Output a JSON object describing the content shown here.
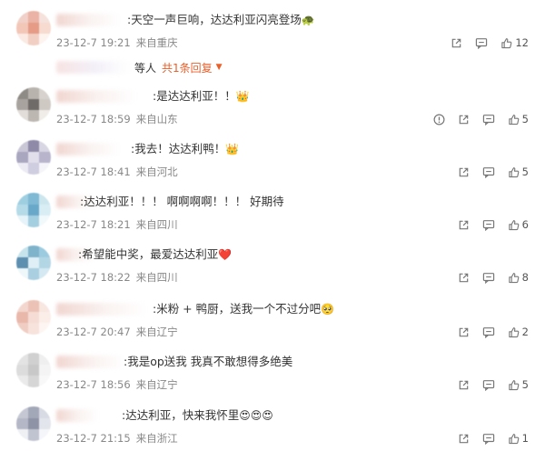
{
  "comments": [
    {
      "text": ":天空一声巨响，达达利亚闪亮登场",
      "text_emoji": "🐢",
      "date": "23-12-7 19:21",
      "location": "来自重庆",
      "likes": "12",
      "has_report": false,
      "replies": {
        "who": "等人",
        "link": "共1条回复",
        "caret": "▼"
      },
      "avatar_colors": [
        "#f0d0c8",
        "#eab3a5",
        "#f5e2dc",
        "#f3c7b8",
        "#e59b85",
        "#f7dad0",
        "#fbe9e3",
        "#f1cfc3",
        "#fdf3ef"
      ]
    },
    {
      "text": ":是达达利亚！！",
      "text_emoji": "👑",
      "date": "23-12-7 18:59",
      "location": "来自山东",
      "likes": "5",
      "has_report": true,
      "avatar_colors": [
        "#8e8a86",
        "#b9b3ae",
        "#d7d2cd",
        "#a8a39e",
        "#6f6b68",
        "#cfc9c4",
        "#e2ddd8",
        "#bdb7b1",
        "#f0ece8"
      ]
    },
    {
      "text": ":我去！达达利鸭！",
      "text_emoji": "👑",
      "date": "23-12-7 18:41",
      "location": "来自河北",
      "likes": "5",
      "has_report": false,
      "avatar_colors": [
        "#c9c7d6",
        "#8f8aa8",
        "#d8d6e2",
        "#a9a6c0",
        "#e1dfea",
        "#b7b4cc",
        "#eceaf2",
        "#cfcde0",
        "#f5f4f8"
      ]
    },
    {
      "text": ":达达利亚！！！ 啊啊啊啊！！！ 好期待",
      "date": "23-12-7 18:21",
      "location": "来自四川",
      "likes": "6",
      "has_report": false,
      "avatar_colors": [
        "#9ecfe0",
        "#7fb9d4",
        "#cde6ee",
        "#b5dbe8",
        "#6aa8c9",
        "#d9eef4",
        "#e6f3f8",
        "#a4cfe0",
        "#f2f9fb"
      ]
    },
    {
      "text": ":希望能中奖，最爱达达利亚",
      "text_emoji": "❤️",
      "date": "23-12-7 18:22",
      "location": "来自四川",
      "likes": "8",
      "has_report": false,
      "avatar_colors": [
        "#c7e3ec",
        "#7fb3cc",
        "#9ccbe0",
        "#5c8fb0",
        "#e0eff5",
        "#b3d6e5",
        "#eef7fa",
        "#a9cfe0",
        "#d4e9f1"
      ]
    },
    {
      "text": ":米粉 + 鸭厨，送我一个不过分吧",
      "text_emoji": "🥺",
      "date": "23-12-7 20:47",
      "location": "来自辽宁",
      "likes": "2",
      "has_report": false,
      "avatar_colors": [
        "#f3d7cf",
        "#ecc2b6",
        "#f8e6e0",
        "#e9b8ab",
        "#f5ddd5",
        "#fbeee9",
        "#f0cdc2",
        "#f7e2dc",
        "#fdf5f2"
      ]
    },
    {
      "text": ":我是op送我  我真不敢想得多绝美",
      "date": "23-12-7 18:56",
      "location": "来自辽宁",
      "likes": "5",
      "has_report": false,
      "avatar_colors": [
        "#e3e3e3",
        "#d0d0d0",
        "#efefef",
        "#dcdcdc",
        "#c8c8c8",
        "#f4f4f4",
        "#eaeaea",
        "#d6d6d6",
        "#f8f8f8"
      ]
    },
    {
      "text": ":达达利亚，快来我怀里",
      "text_emoji": "😍😍😍",
      "date": "23-12-7 21:15",
      "location": "来自浙江",
      "likes": "1",
      "has_report": false,
      "avatar_colors": [
        "#c5c8d3",
        "#a3a8b8",
        "#d8dbe3",
        "#b4b8c6",
        "#8e93a6",
        "#e3e5ec",
        "#eef0f4",
        "#c0c4d0",
        "#f5f6f9"
      ]
    }
  ],
  "colors": {
    "accent": "#e8602c",
    "meta": "#888888",
    "text": "#333333"
  },
  "icons": {
    "report": "report-icon",
    "share": "share-icon",
    "comment": "comment-icon",
    "like": "like-icon"
  }
}
